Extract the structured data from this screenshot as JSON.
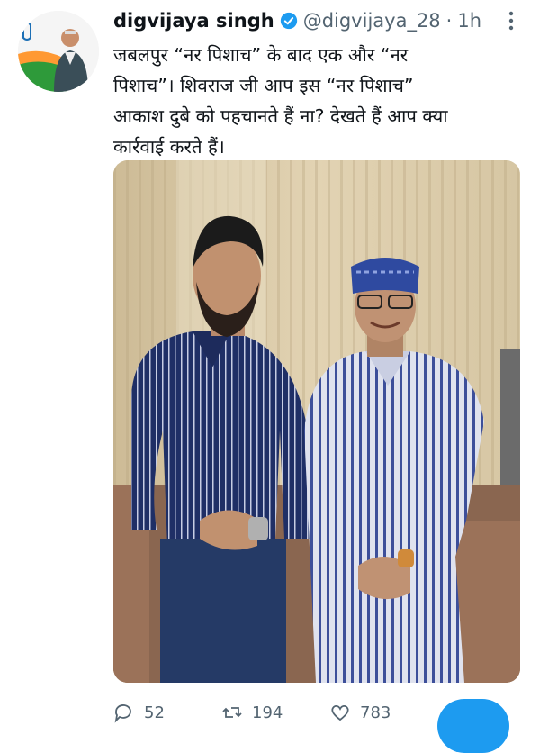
{
  "tweet": {
    "display_name": "digvijaya singh",
    "handle": "@digvijaya_28",
    "separator": "·",
    "time": "1h",
    "verified": true,
    "text": "जबलपुर “नर पिशाच” के बाद एक और “नर\nपिशाच”। शिवराज जी आप इस “नर पिशाच”\nआकाश दुबे को पहचानते हैं ना? देखते हैं आप क्या\nकार्रवाई करते हैं।"
  },
  "actions": {
    "replies": "52",
    "retweets": "194",
    "likes": "783"
  },
  "icons": {
    "verified": "verified-badge-icon",
    "more": "more-vertical-icon",
    "reply": "reply-icon",
    "retweet": "retweet-icon",
    "like": "heart-icon"
  },
  "colors": {
    "accent": "#1d9bf0",
    "text": "#0f1419",
    "muted": "#536471"
  }
}
